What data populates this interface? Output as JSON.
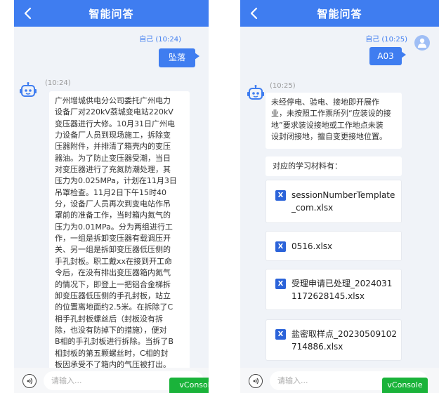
{
  "left": {
    "header": {
      "title": "智能问答"
    },
    "user_msg": {
      "meta": "自己 (10:24)",
      "text": "坠落"
    },
    "bot_msg": {
      "time": "(10:24)",
      "lines": [
        "广州增城供电分公司委托广州电力",
        "设备厂对220kV荔城变电站220kV",
        "变压器进行大修。10月31日广州电",
        "力设备厂人员到现场施工，拆除变",
        "压器附件，并排清了箱壳内的变压",
        "器油。为了防止变压器受潮，当日",
        "对变压器进行了充氮防潮处理，其",
        "压力为0.025MPa，计划在11月3日",
        "吊罩检查。11月2日下午15时40",
        "分，设备厂人员再次到变电站作吊",
        "罩前的准备工作，当时箱内氮气的",
        "压力为0.01MPa。分为两组进行工",
        "作，一组是拆卸变压器有载调压开",
        "关、另一组是拆卸变压器低压侧的",
        "手孔封板。职工戴xx在接到开工命",
        "令后，在没有排出变压器箱内氮气",
        "的情况下，即登上一把铝合金梯拆",
        "卸变压器低压侧的手孔封板，站立",
        "的位置离地面约2.5米。在拆除了C",
        "相手孔封板螺丝后（封板没有拆",
        "除，也没有防掉下的措施），便对",
        "B相的手孔封板进行拆除。当拆了B",
        "相封板的第五颗螺丝时，C相的封",
        "板因承受不了箱内的气压被打出。"
      ]
    },
    "input": {
      "placeholder": "请输入..."
    },
    "vconsole": "vConsole"
  },
  "right": {
    "header": {
      "title": "智能问答"
    },
    "user_msg": {
      "meta": "自己 (10:25)",
      "text": "A03"
    },
    "bot_msg": {
      "time": "(10:25)",
      "lines": [
        "未经停电、验电、接地即开展作",
        "业，未按照工作票所列“应装设的接",
        "地”要求装设接地或工作地点未装",
        "设封闭接地，擅自变更接地位置。"
      ]
    },
    "study_label": "对应的学习材料有：",
    "files": [
      {
        "icon": "X",
        "name": "sessionNumberTemplate_com.xlsx"
      },
      {
        "icon": "X",
        "name": "0516.xlsx"
      },
      {
        "icon": "X",
        "name": "受理申请已处理_20240311172628145.xlsx"
      },
      {
        "icon": "X",
        "name": "盐密取样点_20230509102714886.xlsx"
      }
    ],
    "input": {
      "placeholder": "请输入..."
    },
    "vconsole": "vConsole"
  },
  "colors": {
    "header": "#3f7df0",
    "vconsole": "#1ab33a",
    "excel_icon": "#2b63d9"
  },
  "icons": [
    "back-chevron-icon",
    "user-avatar-icon",
    "robot-icon",
    "voice-icon",
    "excel-file-icon"
  ]
}
